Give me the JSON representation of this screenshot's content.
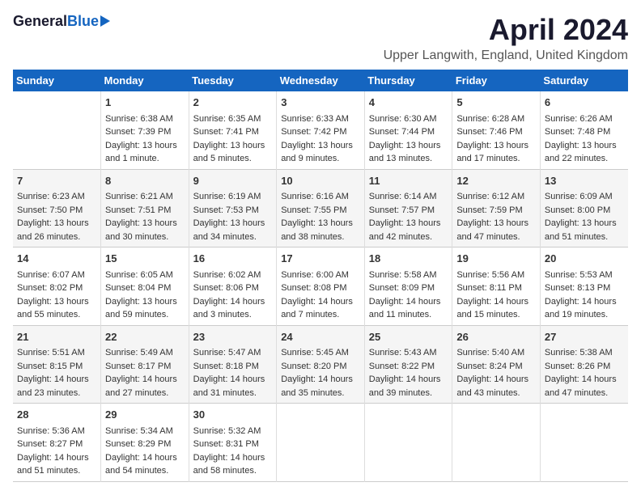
{
  "header": {
    "logo_general": "General",
    "logo_blue": "Blue",
    "month_title": "April 2024",
    "location": "Upper Langwith, England, United Kingdom"
  },
  "calendar": {
    "days_of_week": [
      "Sunday",
      "Monday",
      "Tuesday",
      "Wednesday",
      "Thursday",
      "Friday",
      "Saturday"
    ],
    "weeks": [
      [
        {
          "day": "",
          "sunrise": "",
          "sunset": "",
          "daylight": ""
        },
        {
          "day": "1",
          "sunrise": "Sunrise: 6:38 AM",
          "sunset": "Sunset: 7:39 PM",
          "daylight": "Daylight: 13 hours and 1 minute."
        },
        {
          "day": "2",
          "sunrise": "Sunrise: 6:35 AM",
          "sunset": "Sunset: 7:41 PM",
          "daylight": "Daylight: 13 hours and 5 minutes."
        },
        {
          "day": "3",
          "sunrise": "Sunrise: 6:33 AM",
          "sunset": "Sunset: 7:42 PM",
          "daylight": "Daylight: 13 hours and 9 minutes."
        },
        {
          "day": "4",
          "sunrise": "Sunrise: 6:30 AM",
          "sunset": "Sunset: 7:44 PM",
          "daylight": "Daylight: 13 hours and 13 minutes."
        },
        {
          "day": "5",
          "sunrise": "Sunrise: 6:28 AM",
          "sunset": "Sunset: 7:46 PM",
          "daylight": "Daylight: 13 hours and 17 minutes."
        },
        {
          "day": "6",
          "sunrise": "Sunrise: 6:26 AM",
          "sunset": "Sunset: 7:48 PM",
          "daylight": "Daylight: 13 hours and 22 minutes."
        }
      ],
      [
        {
          "day": "7",
          "sunrise": "Sunrise: 6:23 AM",
          "sunset": "Sunset: 7:50 PM",
          "daylight": "Daylight: 13 hours and 26 minutes."
        },
        {
          "day": "8",
          "sunrise": "Sunrise: 6:21 AM",
          "sunset": "Sunset: 7:51 PM",
          "daylight": "Daylight: 13 hours and 30 minutes."
        },
        {
          "day": "9",
          "sunrise": "Sunrise: 6:19 AM",
          "sunset": "Sunset: 7:53 PM",
          "daylight": "Daylight: 13 hours and 34 minutes."
        },
        {
          "day": "10",
          "sunrise": "Sunrise: 6:16 AM",
          "sunset": "Sunset: 7:55 PM",
          "daylight": "Daylight: 13 hours and 38 minutes."
        },
        {
          "day": "11",
          "sunrise": "Sunrise: 6:14 AM",
          "sunset": "Sunset: 7:57 PM",
          "daylight": "Daylight: 13 hours and 42 minutes."
        },
        {
          "day": "12",
          "sunrise": "Sunrise: 6:12 AM",
          "sunset": "Sunset: 7:59 PM",
          "daylight": "Daylight: 13 hours and 47 minutes."
        },
        {
          "day": "13",
          "sunrise": "Sunrise: 6:09 AM",
          "sunset": "Sunset: 8:00 PM",
          "daylight": "Daylight: 13 hours and 51 minutes."
        }
      ],
      [
        {
          "day": "14",
          "sunrise": "Sunrise: 6:07 AM",
          "sunset": "Sunset: 8:02 PM",
          "daylight": "Daylight: 13 hours and 55 minutes."
        },
        {
          "day": "15",
          "sunrise": "Sunrise: 6:05 AM",
          "sunset": "Sunset: 8:04 PM",
          "daylight": "Daylight: 13 hours and 59 minutes."
        },
        {
          "day": "16",
          "sunrise": "Sunrise: 6:02 AM",
          "sunset": "Sunset: 8:06 PM",
          "daylight": "Daylight: 14 hours and 3 minutes."
        },
        {
          "day": "17",
          "sunrise": "Sunrise: 6:00 AM",
          "sunset": "Sunset: 8:08 PM",
          "daylight": "Daylight: 14 hours and 7 minutes."
        },
        {
          "day": "18",
          "sunrise": "Sunrise: 5:58 AM",
          "sunset": "Sunset: 8:09 PM",
          "daylight": "Daylight: 14 hours and 11 minutes."
        },
        {
          "day": "19",
          "sunrise": "Sunrise: 5:56 AM",
          "sunset": "Sunset: 8:11 PM",
          "daylight": "Daylight: 14 hours and 15 minutes."
        },
        {
          "day": "20",
          "sunrise": "Sunrise: 5:53 AM",
          "sunset": "Sunset: 8:13 PM",
          "daylight": "Daylight: 14 hours and 19 minutes."
        }
      ],
      [
        {
          "day": "21",
          "sunrise": "Sunrise: 5:51 AM",
          "sunset": "Sunset: 8:15 PM",
          "daylight": "Daylight: 14 hours and 23 minutes."
        },
        {
          "day": "22",
          "sunrise": "Sunrise: 5:49 AM",
          "sunset": "Sunset: 8:17 PM",
          "daylight": "Daylight: 14 hours and 27 minutes."
        },
        {
          "day": "23",
          "sunrise": "Sunrise: 5:47 AM",
          "sunset": "Sunset: 8:18 PM",
          "daylight": "Daylight: 14 hours and 31 minutes."
        },
        {
          "day": "24",
          "sunrise": "Sunrise: 5:45 AM",
          "sunset": "Sunset: 8:20 PM",
          "daylight": "Daylight: 14 hours and 35 minutes."
        },
        {
          "day": "25",
          "sunrise": "Sunrise: 5:43 AM",
          "sunset": "Sunset: 8:22 PM",
          "daylight": "Daylight: 14 hours and 39 minutes."
        },
        {
          "day": "26",
          "sunrise": "Sunrise: 5:40 AM",
          "sunset": "Sunset: 8:24 PM",
          "daylight": "Daylight: 14 hours and 43 minutes."
        },
        {
          "day": "27",
          "sunrise": "Sunrise: 5:38 AM",
          "sunset": "Sunset: 8:26 PM",
          "daylight": "Daylight: 14 hours and 47 minutes."
        }
      ],
      [
        {
          "day": "28",
          "sunrise": "Sunrise: 5:36 AM",
          "sunset": "Sunset: 8:27 PM",
          "daylight": "Daylight: 14 hours and 51 minutes."
        },
        {
          "day": "29",
          "sunrise": "Sunrise: 5:34 AM",
          "sunset": "Sunset: 8:29 PM",
          "daylight": "Daylight: 14 hours and 54 minutes."
        },
        {
          "day": "30",
          "sunrise": "Sunrise: 5:32 AM",
          "sunset": "Sunset: 8:31 PM",
          "daylight": "Daylight: 14 hours and 58 minutes."
        },
        {
          "day": "",
          "sunrise": "",
          "sunset": "",
          "daylight": ""
        },
        {
          "day": "",
          "sunrise": "",
          "sunset": "",
          "daylight": ""
        },
        {
          "day": "",
          "sunrise": "",
          "sunset": "",
          "daylight": ""
        },
        {
          "day": "",
          "sunrise": "",
          "sunset": "",
          "daylight": ""
        }
      ]
    ]
  }
}
